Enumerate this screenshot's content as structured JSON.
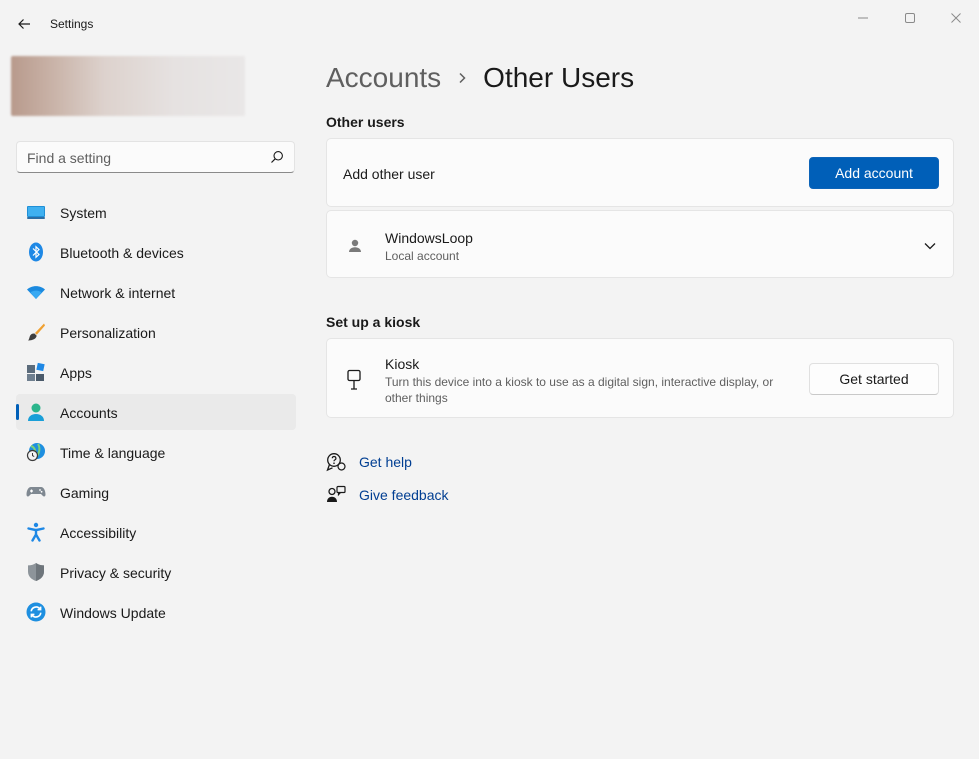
{
  "window": {
    "title": "Settings",
    "back_icon": "back-arrow-icon",
    "controls": [
      "minimize-icon",
      "maximize-icon",
      "close-icon"
    ]
  },
  "search": {
    "placeholder": "Find a setting",
    "value": ""
  },
  "sidebar": {
    "items": [
      {
        "label": "System",
        "icon": "system-icon",
        "active": false
      },
      {
        "label": "Bluetooth & devices",
        "icon": "bluetooth-icon",
        "active": false
      },
      {
        "label": "Network & internet",
        "icon": "wifi-icon",
        "active": false
      },
      {
        "label": "Personalization",
        "icon": "paintbrush-icon",
        "active": false
      },
      {
        "label": "Apps",
        "icon": "apps-icon",
        "active": false
      },
      {
        "label": "Accounts",
        "icon": "accounts-icon",
        "active": true
      },
      {
        "label": "Time & language",
        "icon": "time-language-icon",
        "active": false
      },
      {
        "label": "Gaming",
        "icon": "gamepad-icon",
        "active": false
      },
      {
        "label": "Accessibility",
        "icon": "accessibility-icon",
        "active": false
      },
      {
        "label": "Privacy & security",
        "icon": "shield-icon",
        "active": false
      },
      {
        "label": "Windows Update",
        "icon": "update-icon",
        "active": false
      }
    ]
  },
  "breadcrumb": {
    "parent": "Accounts",
    "current": "Other Users"
  },
  "other_users": {
    "heading": "Other users",
    "add_label": "Add other user",
    "add_button": "Add account",
    "user": {
      "name": "WindowsLoop",
      "type": "Local account"
    }
  },
  "kiosk": {
    "heading": "Set up a kiosk",
    "title": "Kiosk",
    "description_line1": "Turn this device into a kiosk to use as a digital sign, interactive display, or",
    "description_line2": "other things",
    "button": "Get started"
  },
  "links": {
    "help": "Get help",
    "feedback": "Give feedback"
  },
  "colors": {
    "accent": "#005fb8",
    "background": "#f3f3f3",
    "card": "#fbfbfb",
    "link": "#003e92"
  }
}
